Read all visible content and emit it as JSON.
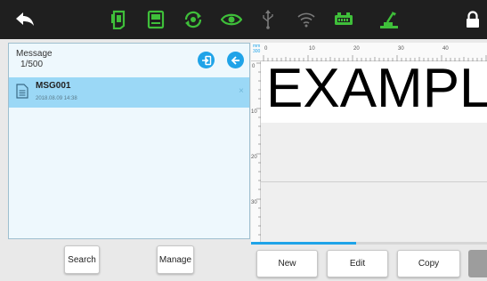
{
  "toolbar": {
    "icons": [
      "back-arrow-icon",
      "print-head-icon",
      "printer-screen-icon",
      "refresh-cycle-icon",
      "eye-icon",
      "usb-icon",
      "wifi-icon",
      "battery-icon",
      "service-tool-icon",
      "lock-icon"
    ],
    "accent_color": "#3fbf3a"
  },
  "message_panel": {
    "title": "Message",
    "count": "1/500",
    "items": [
      {
        "name": "MSG001",
        "date": "2018.08.09 14:38"
      }
    ]
  },
  "left_buttons": {
    "search": "Search",
    "manage": "Manage"
  },
  "editor": {
    "unit_label": "mm",
    "unit_value": "300",
    "top_ruler_labels": [
      "0",
      "10",
      "20",
      "30",
      "40"
    ],
    "left_ruler_labels": [
      "0",
      "10",
      "20",
      "30"
    ],
    "canvas_text": "EXAMPLE"
  },
  "bottom_buttons": {
    "new": "New",
    "edit": "Edit",
    "copy": "Copy"
  },
  "colors": {
    "toolbar_bg": "#1f1f1f",
    "selection": "#9bd8f6",
    "accent_blue": "#1fa3e8"
  }
}
